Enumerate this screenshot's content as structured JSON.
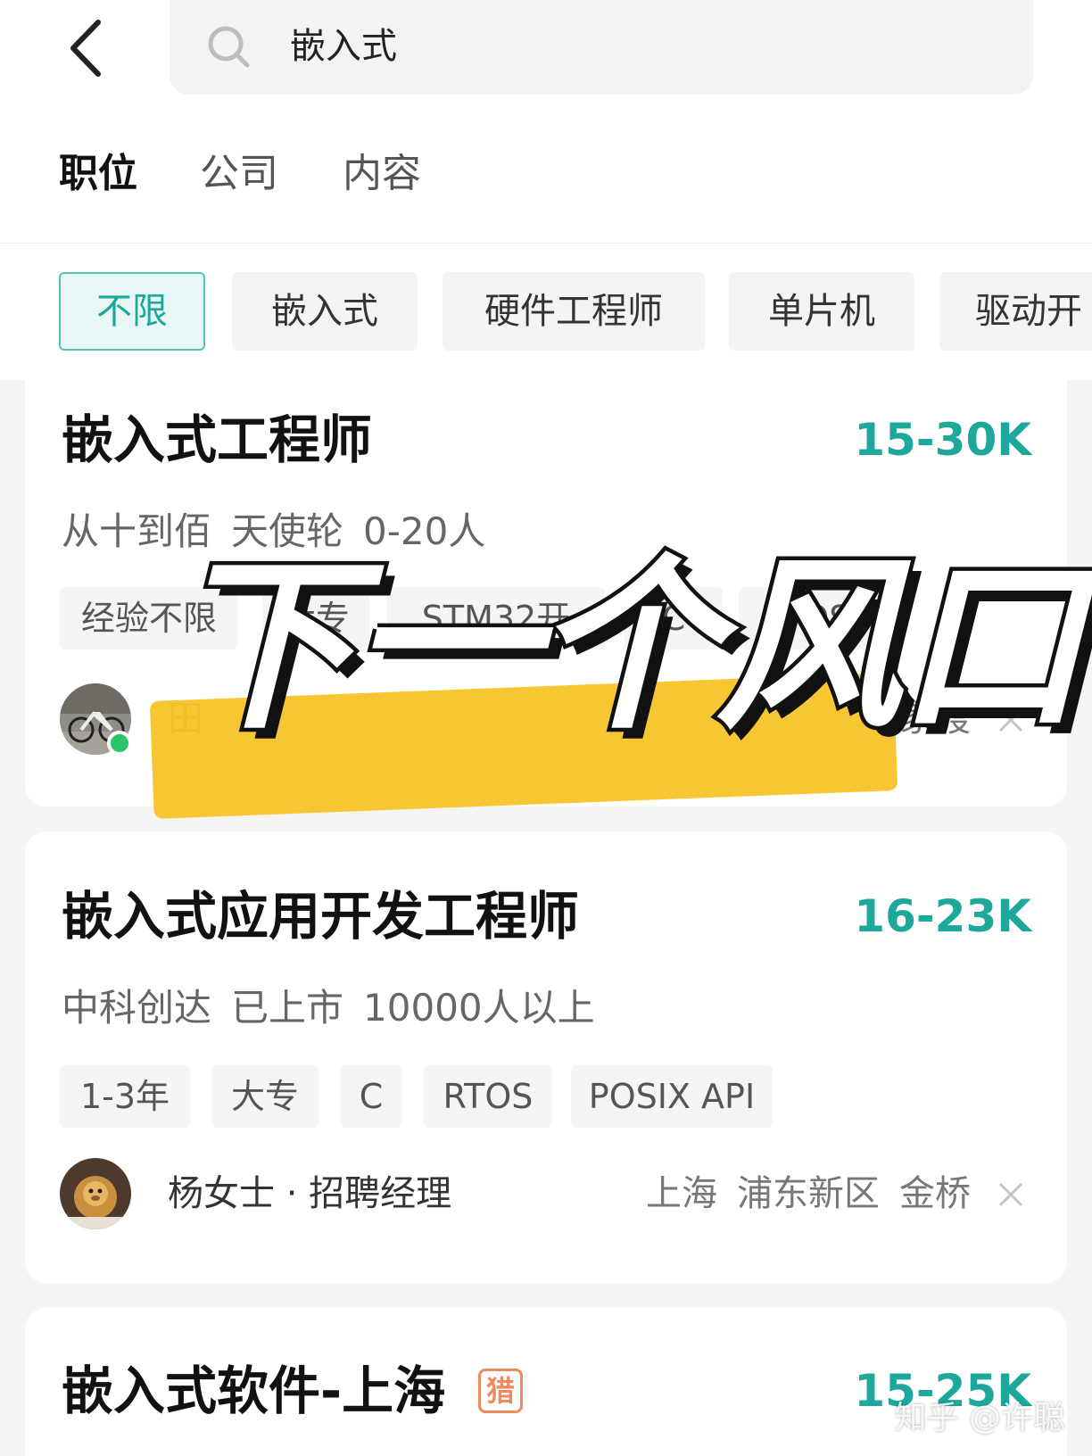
{
  "search": {
    "query": "嵌入式"
  },
  "tabs": [
    {
      "label": "职位",
      "active": true
    },
    {
      "label": "公司",
      "active": false
    },
    {
      "label": "内容",
      "active": false
    }
  ],
  "filters": [
    {
      "label": "不限",
      "active": true
    },
    {
      "label": "嵌入式",
      "active": false
    },
    {
      "label": "硬件工程师",
      "active": false
    },
    {
      "label": "单片机",
      "active": false
    },
    {
      "label": "驱动开",
      "active": false
    }
  ],
  "jobs": [
    {
      "title": "嵌入式工程师",
      "salary": "15-30K",
      "company": [
        "从十到佰",
        "天使轮",
        "0-20人"
      ],
      "tags": [
        "经验不限",
        "大专",
        "STM32开",
        "C",
        "RTOS"
      ],
      "recruiter": "田",
      "location": [
        "家渡"
      ],
      "online": true
    },
    {
      "title": "嵌入式应用开发工程师",
      "salary": "16-23K",
      "company": [
        "中科创达",
        "已上市",
        "10000人以上"
      ],
      "tags": [
        "1-3年",
        "大专",
        "C",
        "RTOS",
        "POSIX API"
      ],
      "recruiter": "杨女士 · 招聘经理",
      "location": [
        "上海",
        "浦东新区",
        "金桥"
      ],
      "online": false
    },
    {
      "title": "嵌入式软件-上海",
      "salary": "15-25K",
      "badge": "猎"
    }
  ],
  "overlay": {
    "text": "下一个风口"
  },
  "watermark": "知乎 @许聪",
  "colors": {
    "accent": "#1ea89c",
    "highlight": "#f7c52b",
    "online": "#2bc46a",
    "hunter": "#f08a5d"
  }
}
